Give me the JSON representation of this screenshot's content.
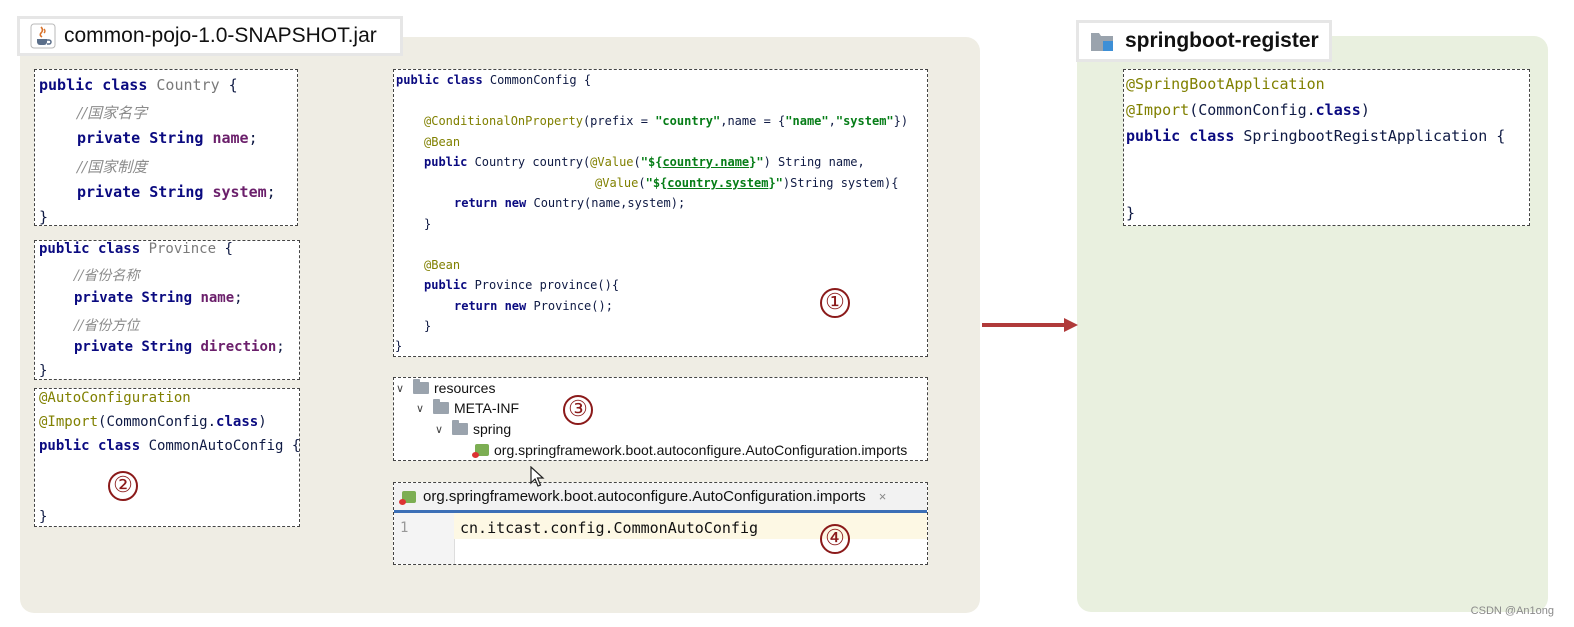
{
  "left_title": "common-pojo-1.0-SNAPSHOT.jar",
  "right_title": "springboot-register",
  "country_box": {
    "l1": [
      "public class ",
      "Country",
      " {"
    ],
    "c1": "//国家名字",
    "l3": [
      "private String ",
      "name",
      ";"
    ],
    "c2": "//国家制度",
    "l5": [
      "private String ",
      "system",
      ";"
    ],
    "close": "}"
  },
  "province_box": {
    "l1": [
      "public class ",
      "Province",
      " {"
    ],
    "c1": "//省份名称",
    "l3": [
      "private String ",
      "name",
      ";"
    ],
    "c2": "//省份方位",
    "l5": [
      "private String ",
      "direction",
      ";"
    ],
    "close": "}"
  },
  "autoconfig_box": {
    "ann1": "@AutoConfiguration",
    "imp": [
      "@Import",
      "(CommonConfig.",
      "class",
      ")"
    ],
    "decl": [
      "public class ",
      "CommonAutoConfig {"
    ],
    "close": "}"
  },
  "commonconfig_box": {
    "l1": [
      "public class ",
      "CommonConfig {"
    ],
    "cond": [
      "@ConditionalOnProperty",
      "(prefix = ",
      "\"country\"",
      ",name = {",
      "\"name\"",
      ",",
      "\"system\"",
      "})"
    ],
    "bean1": "@Bean",
    "m1": [
      "public ",
      "Country country(",
      "@Value",
      "(",
      "\"${",
      "country.name",
      "}\"",
      ") String name,"
    ],
    "m1b": [
      "@Value",
      "(",
      "\"${",
      "country.system",
      "}\"",
      ")String system){"
    ],
    "ret1": [
      "return new ",
      "Country(name,system);"
    ],
    "close1": "}",
    "bean2": "@Bean",
    "m2": [
      "public ",
      "Province province(){"
    ],
    "ret2": [
      "return new ",
      "Province();"
    ],
    "close2": "}",
    "close": "}"
  },
  "resources_tree": {
    "root": "resources",
    "meta": "META-INF",
    "spring": "spring",
    "file": "org.springframework.boot.autoconfigure.AutoConfiguration.imports"
  },
  "editor": {
    "tab": "org.springframework.boot.autoconfigure.AutoConfiguration.imports",
    "close": "×",
    "line_no": "1",
    "code": "cn.itcast.config.CommonAutoConfig"
  },
  "register_box": {
    "ann1": "@SpringBootApplication",
    "imp": [
      "@Import",
      "(CommonConfig.",
      "class",
      ")"
    ],
    "decl": [
      "public class ",
      "SpringbootRegistApplication {"
    ],
    "close": "}"
  },
  "markers": [
    "①",
    "②",
    "③",
    "④"
  ],
  "watermark": "CSDN @An1ong",
  "colors": {
    "left_bg": "#efede4",
    "right_bg": "#e9f0df",
    "arrow": "#b03a3a",
    "marker": "#8b1a1a"
  }
}
